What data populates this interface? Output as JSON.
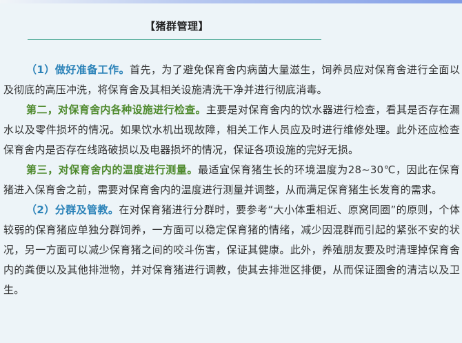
{
  "header": {
    "title": "【猪群管理】"
  },
  "colors": {
    "blue_heading": "#2b82b8",
    "green_heading": "#4f8a2e",
    "underline": "#3aa08a",
    "background": "#edf4f8"
  },
  "paragraphs": [
    {
      "heading": "（1）做好准备工作。",
      "body": "首先，为了避免保育舍内病菌大量滋生，饲养员应对保育舍进行全面以及彻底的高压冲洗，将保育舍及其相关设施清洗干净并进行彻底消毒。"
    },
    {
      "heading": "第二，对保育舍内各种设施进行检查。",
      "body": "主要是对保育舍内的饮水器进行检查，看其是否存在漏水以及零件损坏的情况。如果饮水机出现故障，相关工作人员应及时进行维修处理。此外还应检查保育舍内是否存在线路破损以及电器损坏的情况，保证各项设施的完好无损。"
    },
    {
      "heading": "第三，对保育舍内的温度进行测量。",
      "body": "最适宜保育猪生长的环境温度为28~30℃，因此在保育猪进入保育舍之前，需要对保育舍内的温度进行测量并调整，从而满足保育猪生长发育的需求。"
    },
    {
      "heading": "（2）分群及管教。",
      "body": "在对保育猪进行分群时，要参考“大小体重相近、原窝同圈”的原则，个体较弱的保育猪应单独分群饲养，一方面可以稳定保育猪的情绪，减少因混群而引起的紧张不安的状况，另一方面可以减少保育猪之间的咬斗伤害，保证其健康。此外，养殖朋友要及时清理掉保育舍内的粪便以及其他排泄物，并对保育猪进行调教，使其去排泄区排便，从而保证圈舍的清洁以及卫生。"
    }
  ]
}
